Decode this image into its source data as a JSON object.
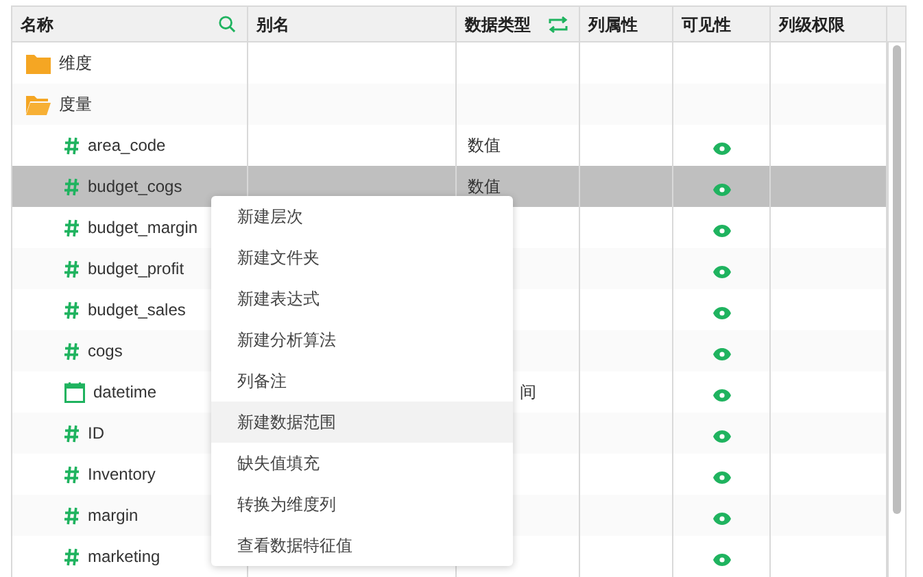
{
  "columns": [
    {
      "label": "名称"
    },
    {
      "label": "别名"
    },
    {
      "label": "数据类型"
    },
    {
      "label": "列属性"
    },
    {
      "label": "可见性"
    },
    {
      "label": "列级权限"
    }
  ],
  "rows": [
    {
      "kind": "folder",
      "name": "维度",
      "expanded": false,
      "selected": false
    },
    {
      "kind": "folder",
      "name": "度量",
      "expanded": true,
      "selected": false
    },
    {
      "kind": "number",
      "name": "area_code",
      "type": "数值",
      "visible": true,
      "selected": false
    },
    {
      "kind": "number",
      "name": "budget_cogs",
      "type": "数值",
      "visible": true,
      "selected": true
    },
    {
      "kind": "number",
      "name": "budget_margin",
      "visible": true,
      "selected": false
    },
    {
      "kind": "number",
      "name": "budget_profit",
      "visible": true,
      "selected": false
    },
    {
      "kind": "number",
      "name": "budget_sales",
      "visible": true,
      "selected": false
    },
    {
      "kind": "number",
      "name": "cogs",
      "visible": true,
      "selected": false
    },
    {
      "kind": "date",
      "name": "datetime",
      "type": "间",
      "type_partly_hidden": true,
      "visible": true,
      "selected": false
    },
    {
      "kind": "number",
      "name": "ID",
      "visible": true,
      "selected": false
    },
    {
      "kind": "number",
      "name": "Inventory",
      "visible": true,
      "selected": false
    },
    {
      "kind": "number",
      "name": "margin",
      "visible": true,
      "selected": false
    },
    {
      "kind": "number",
      "name": "marketing",
      "visible": true,
      "selected": false
    }
  ],
  "context_menu": [
    {
      "label": "新建层次",
      "hovered": false
    },
    {
      "label": "新建文件夹",
      "hovered": false
    },
    {
      "label": "新建表达式",
      "hovered": false
    },
    {
      "label": "新建分析算法",
      "hovered": false
    },
    {
      "label": "列备注",
      "hovered": false
    },
    {
      "label": "新建数据范围",
      "hovered": true
    },
    {
      "label": "缺失值填充",
      "hovered": false
    },
    {
      "label": "转换为维度列",
      "hovered": false
    },
    {
      "label": "查看数据特征值",
      "hovered": false
    }
  ]
}
